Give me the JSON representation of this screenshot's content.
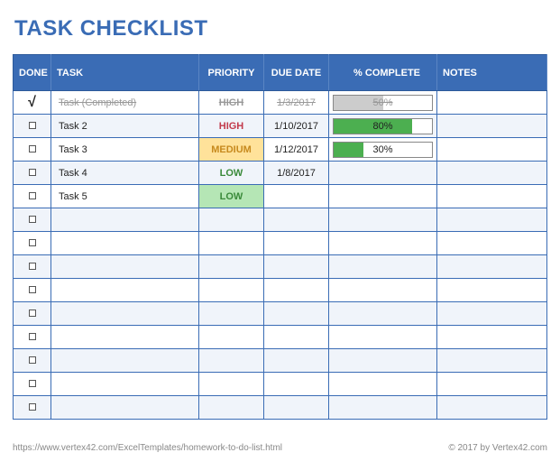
{
  "title": "TASK CHECKLIST",
  "headers": {
    "done": "DONE",
    "task": "TASK",
    "priority": "PRIORITY",
    "duedate": "DUE DATE",
    "complete": "% COMPLETE",
    "notes": "NOTES"
  },
  "rows": [
    {
      "done": true,
      "task": "Task (Completed)",
      "priority": "HIGH",
      "duedate": "1/3/2017",
      "complete": 50,
      "progress_style": "done",
      "notes": "",
      "completed": true
    },
    {
      "done": false,
      "task": "Task 2",
      "priority": "HIGH",
      "duedate": "1/10/2017",
      "complete": 80,
      "progress_style": "green",
      "notes": "",
      "completed": false
    },
    {
      "done": false,
      "task": "Task 3",
      "priority": "MEDIUM",
      "duedate": "1/12/2017",
      "complete": 30,
      "progress_style": "green",
      "notes": "",
      "completed": false
    },
    {
      "done": false,
      "task": "Task 4",
      "priority": "LOW",
      "duedate": "1/8/2017",
      "complete": null,
      "progress_style": null,
      "notes": "",
      "completed": false
    },
    {
      "done": false,
      "task": "Task 5",
      "priority": "LOW",
      "duedate": "",
      "complete": null,
      "progress_style": null,
      "notes": "",
      "completed": false
    }
  ],
  "empty_rows": 9,
  "footer": {
    "left": "https://www.vertex42.com/ExcelTemplates/homework-to-do-list.html",
    "right": "© 2017 by Vertex42.com"
  },
  "chart_data": {
    "type": "table",
    "title": "TASK CHECKLIST",
    "columns": [
      "DONE",
      "TASK",
      "PRIORITY",
      "DUE DATE",
      "% COMPLETE",
      "NOTES"
    ],
    "data": [
      [
        "✓",
        "Task (Completed)",
        "HIGH",
        "1/3/2017",
        "50%",
        ""
      ],
      [
        "",
        "Task 2",
        "HIGH",
        "1/10/2017",
        "80%",
        ""
      ],
      [
        "",
        "Task 3",
        "MEDIUM",
        "1/12/2017",
        "30%",
        ""
      ],
      [
        "",
        "Task 4",
        "LOW",
        "1/8/2017",
        "",
        ""
      ],
      [
        "",
        "Task 5",
        "LOW",
        "",
        "",
        ""
      ]
    ]
  }
}
